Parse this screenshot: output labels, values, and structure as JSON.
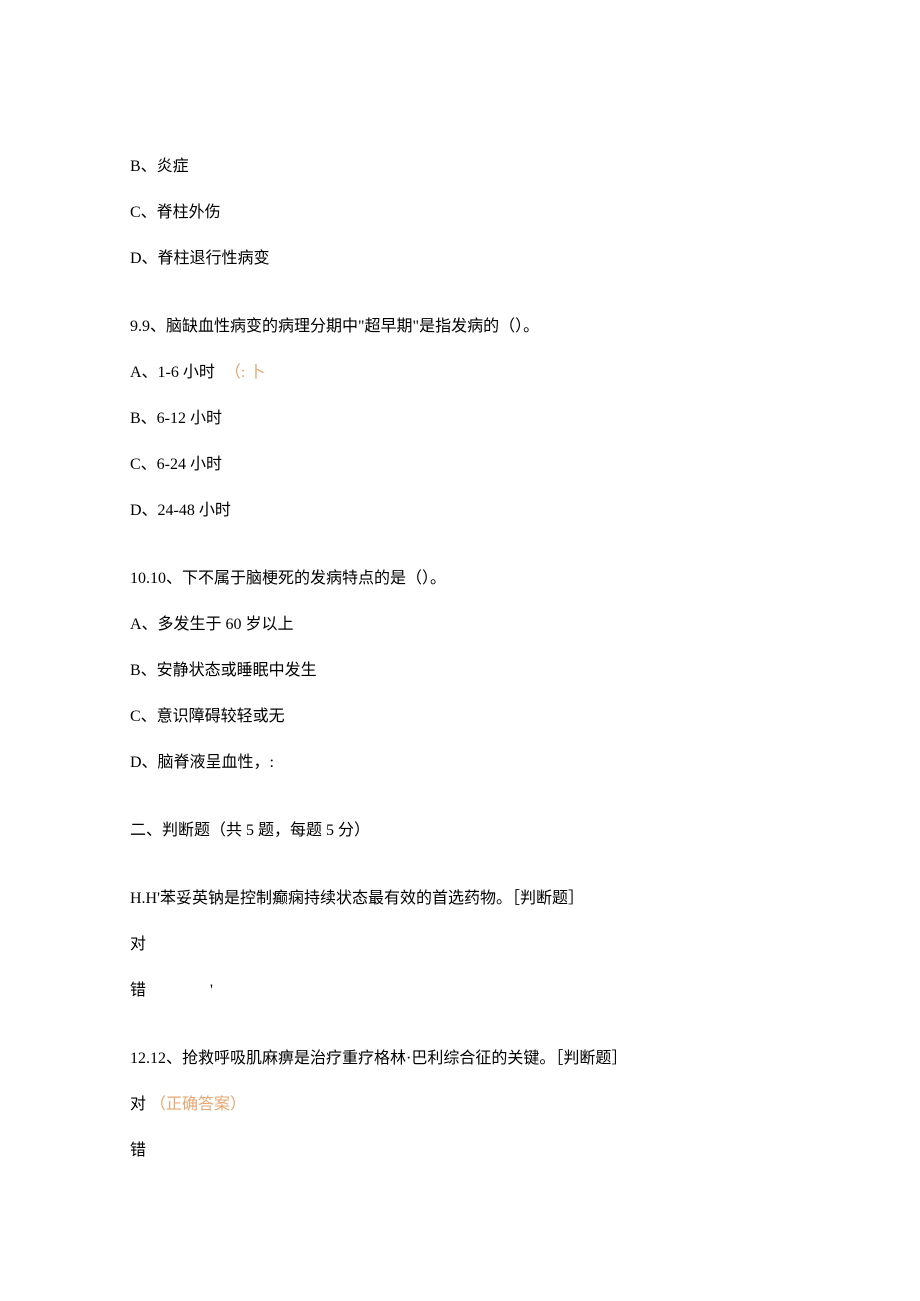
{
  "q8": {
    "opt_b": "B、炎症",
    "opt_c": "C、脊柱外伤",
    "opt_d": "D、脊柱退行性病变"
  },
  "q9": {
    "stem": "9.9、脑缺血性病变的病理分期中\"超早期\"是指发病的（）。",
    "opt_a_prefix": "A、1-6 小时",
    "opt_a_mark": "（:  卜",
    "opt_b": "B、6-12 小时",
    "opt_c": "C、6-24 小时",
    "opt_d": "D、24-48 小时"
  },
  "q10": {
    "stem": "10.10、下不属于脑梗死的发病特点的是（）。",
    "opt_a": "A、多发生于 60 岁以上",
    "opt_b": "B、安静状态或睡眠中发生",
    "opt_c": "C、意识障碍较轻或无",
    "opt_d": "D、脑脊液呈血性，:"
  },
  "section2": {
    "header": "二、判断题（共 5 题，每题 5 分）"
  },
  "q11": {
    "stem": "H.H'苯妥英钠是控制癫痫持续状态最有效的首选药物。［判断题］",
    "opt_true": "对",
    "opt_false": "错",
    "opt_false_mark": "'"
  },
  "q12": {
    "stem": "12.12、抢救呼吸肌麻痹是治疗重疗格林·巴利综合征的关键。［判断题］",
    "opt_true": "对",
    "opt_true_mark": "（正确答案）",
    "opt_false": "错"
  }
}
